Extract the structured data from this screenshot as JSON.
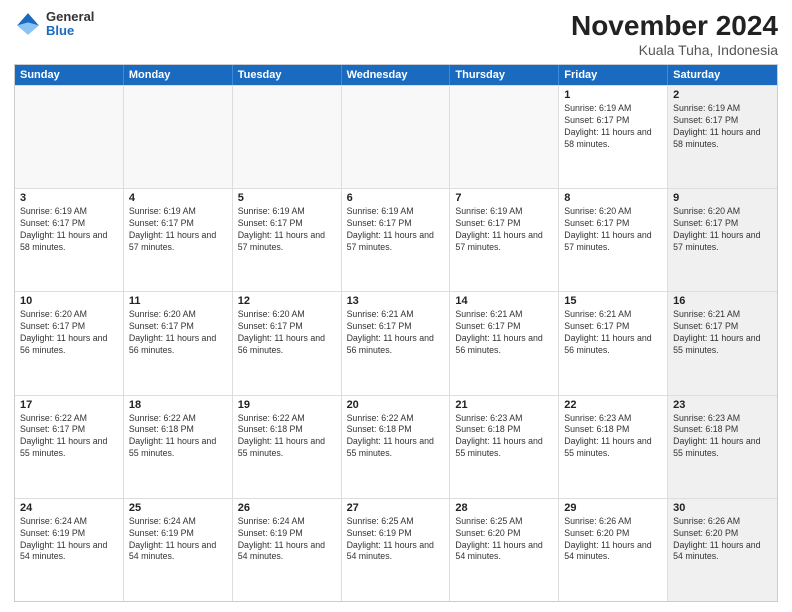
{
  "header": {
    "logo": {
      "general": "General",
      "blue": "Blue"
    },
    "title": "November 2024",
    "subtitle": "Kuala Tuha, Indonesia"
  },
  "weekdays": [
    "Sunday",
    "Monday",
    "Tuesday",
    "Wednesday",
    "Thursday",
    "Friday",
    "Saturday"
  ],
  "rows": [
    {
      "cells": [
        {
          "empty": true
        },
        {
          "empty": true
        },
        {
          "empty": true
        },
        {
          "empty": true
        },
        {
          "empty": true
        },
        {
          "day": "1",
          "shaded": false,
          "sunrise": "Sunrise: 6:19 AM",
          "sunset": "Sunset: 6:17 PM",
          "daylight": "Daylight: 11 hours and 58 minutes."
        },
        {
          "day": "2",
          "shaded": true,
          "sunrise": "Sunrise: 6:19 AM",
          "sunset": "Sunset: 6:17 PM",
          "daylight": "Daylight: 11 hours and 58 minutes."
        }
      ]
    },
    {
      "cells": [
        {
          "day": "3",
          "shaded": false,
          "sunrise": "Sunrise: 6:19 AM",
          "sunset": "Sunset: 6:17 PM",
          "daylight": "Daylight: 11 hours and 58 minutes."
        },
        {
          "day": "4",
          "shaded": false,
          "sunrise": "Sunrise: 6:19 AM",
          "sunset": "Sunset: 6:17 PM",
          "daylight": "Daylight: 11 hours and 57 minutes."
        },
        {
          "day": "5",
          "shaded": false,
          "sunrise": "Sunrise: 6:19 AM",
          "sunset": "Sunset: 6:17 PM",
          "daylight": "Daylight: 11 hours and 57 minutes."
        },
        {
          "day": "6",
          "shaded": false,
          "sunrise": "Sunrise: 6:19 AM",
          "sunset": "Sunset: 6:17 PM",
          "daylight": "Daylight: 11 hours and 57 minutes."
        },
        {
          "day": "7",
          "shaded": false,
          "sunrise": "Sunrise: 6:19 AM",
          "sunset": "Sunset: 6:17 PM",
          "daylight": "Daylight: 11 hours and 57 minutes."
        },
        {
          "day": "8",
          "shaded": false,
          "sunrise": "Sunrise: 6:20 AM",
          "sunset": "Sunset: 6:17 PM",
          "daylight": "Daylight: 11 hours and 57 minutes."
        },
        {
          "day": "9",
          "shaded": true,
          "sunrise": "Sunrise: 6:20 AM",
          "sunset": "Sunset: 6:17 PM",
          "daylight": "Daylight: 11 hours and 57 minutes."
        }
      ]
    },
    {
      "cells": [
        {
          "day": "10",
          "shaded": false,
          "sunrise": "Sunrise: 6:20 AM",
          "sunset": "Sunset: 6:17 PM",
          "daylight": "Daylight: 11 hours and 56 minutes."
        },
        {
          "day": "11",
          "shaded": false,
          "sunrise": "Sunrise: 6:20 AM",
          "sunset": "Sunset: 6:17 PM",
          "daylight": "Daylight: 11 hours and 56 minutes."
        },
        {
          "day": "12",
          "shaded": false,
          "sunrise": "Sunrise: 6:20 AM",
          "sunset": "Sunset: 6:17 PM",
          "daylight": "Daylight: 11 hours and 56 minutes."
        },
        {
          "day": "13",
          "shaded": false,
          "sunrise": "Sunrise: 6:21 AM",
          "sunset": "Sunset: 6:17 PM",
          "daylight": "Daylight: 11 hours and 56 minutes."
        },
        {
          "day": "14",
          "shaded": false,
          "sunrise": "Sunrise: 6:21 AM",
          "sunset": "Sunset: 6:17 PM",
          "daylight": "Daylight: 11 hours and 56 minutes."
        },
        {
          "day": "15",
          "shaded": false,
          "sunrise": "Sunrise: 6:21 AM",
          "sunset": "Sunset: 6:17 PM",
          "daylight": "Daylight: 11 hours and 56 minutes."
        },
        {
          "day": "16",
          "shaded": true,
          "sunrise": "Sunrise: 6:21 AM",
          "sunset": "Sunset: 6:17 PM",
          "daylight": "Daylight: 11 hours and 55 minutes."
        }
      ]
    },
    {
      "cells": [
        {
          "day": "17",
          "shaded": false,
          "sunrise": "Sunrise: 6:22 AM",
          "sunset": "Sunset: 6:17 PM",
          "daylight": "Daylight: 11 hours and 55 minutes."
        },
        {
          "day": "18",
          "shaded": false,
          "sunrise": "Sunrise: 6:22 AM",
          "sunset": "Sunset: 6:18 PM",
          "daylight": "Daylight: 11 hours and 55 minutes."
        },
        {
          "day": "19",
          "shaded": false,
          "sunrise": "Sunrise: 6:22 AM",
          "sunset": "Sunset: 6:18 PM",
          "daylight": "Daylight: 11 hours and 55 minutes."
        },
        {
          "day": "20",
          "shaded": false,
          "sunrise": "Sunrise: 6:22 AM",
          "sunset": "Sunset: 6:18 PM",
          "daylight": "Daylight: 11 hours and 55 minutes."
        },
        {
          "day": "21",
          "shaded": false,
          "sunrise": "Sunrise: 6:23 AM",
          "sunset": "Sunset: 6:18 PM",
          "daylight": "Daylight: 11 hours and 55 minutes."
        },
        {
          "day": "22",
          "shaded": false,
          "sunrise": "Sunrise: 6:23 AM",
          "sunset": "Sunset: 6:18 PM",
          "daylight": "Daylight: 11 hours and 55 minutes."
        },
        {
          "day": "23",
          "shaded": true,
          "sunrise": "Sunrise: 6:23 AM",
          "sunset": "Sunset: 6:18 PM",
          "daylight": "Daylight: 11 hours and 55 minutes."
        }
      ]
    },
    {
      "cells": [
        {
          "day": "24",
          "shaded": false,
          "sunrise": "Sunrise: 6:24 AM",
          "sunset": "Sunset: 6:19 PM",
          "daylight": "Daylight: 11 hours and 54 minutes."
        },
        {
          "day": "25",
          "shaded": false,
          "sunrise": "Sunrise: 6:24 AM",
          "sunset": "Sunset: 6:19 PM",
          "daylight": "Daylight: 11 hours and 54 minutes."
        },
        {
          "day": "26",
          "shaded": false,
          "sunrise": "Sunrise: 6:24 AM",
          "sunset": "Sunset: 6:19 PM",
          "daylight": "Daylight: 11 hours and 54 minutes."
        },
        {
          "day": "27",
          "shaded": false,
          "sunrise": "Sunrise: 6:25 AM",
          "sunset": "Sunset: 6:19 PM",
          "daylight": "Daylight: 11 hours and 54 minutes."
        },
        {
          "day": "28",
          "shaded": false,
          "sunrise": "Sunrise: 6:25 AM",
          "sunset": "Sunset: 6:20 PM",
          "daylight": "Daylight: 11 hours and 54 minutes."
        },
        {
          "day": "29",
          "shaded": false,
          "sunrise": "Sunrise: 6:26 AM",
          "sunset": "Sunset: 6:20 PM",
          "daylight": "Daylight: 11 hours and 54 minutes."
        },
        {
          "day": "30",
          "shaded": true,
          "sunrise": "Sunrise: 6:26 AM",
          "sunset": "Sunset: 6:20 PM",
          "daylight": "Daylight: 11 hours and 54 minutes."
        }
      ]
    }
  ]
}
